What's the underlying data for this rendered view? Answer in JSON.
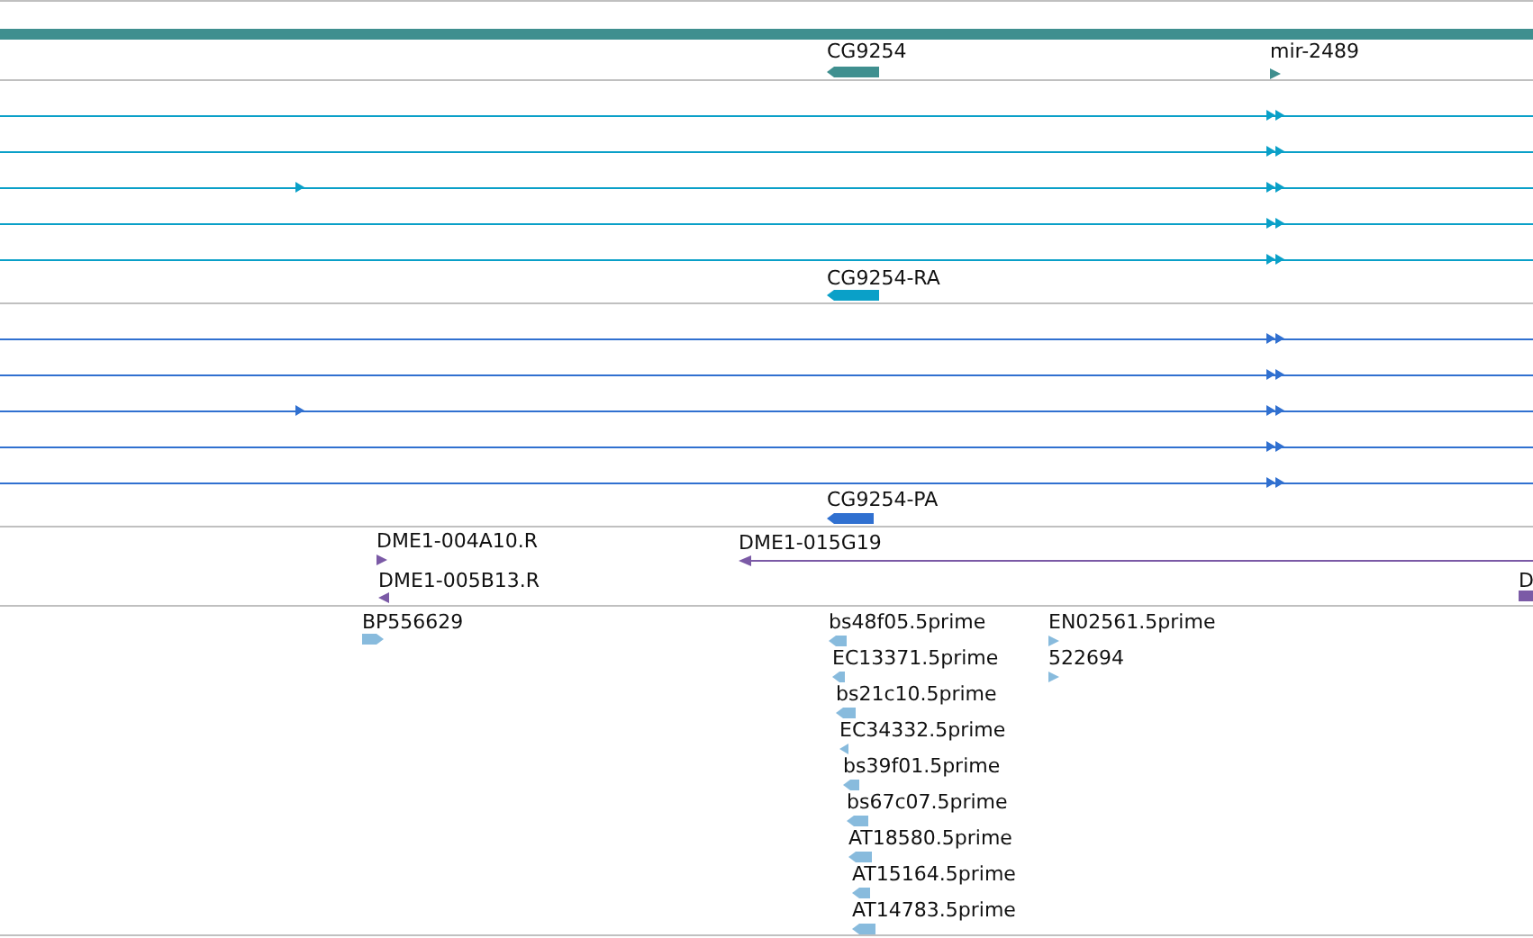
{
  "tracks": [
    {
      "kind": "genes",
      "features": [
        {
          "label": "CG9254",
          "reverse": true
        },
        {
          "label": "mir-2489",
          "reverse": false
        }
      ]
    },
    {
      "kind": "transcripts",
      "rows": [
        {
          "extra_arrow": false
        },
        {
          "extra_arrow": false
        },
        {
          "extra_arrow": true
        },
        {
          "extra_arrow": false
        },
        {
          "extra_arrow": false
        }
      ],
      "features": [
        {
          "label": "CG9254-RA",
          "reverse": true
        }
      ]
    },
    {
      "kind": "proteins",
      "rows": [
        {
          "extra_arrow": false
        },
        {
          "extra_arrow": false
        },
        {
          "extra_arrow": true
        },
        {
          "extra_arrow": false
        },
        {
          "extra_arrow": false
        }
      ],
      "features": [
        {
          "label": "CG9254-PA",
          "reverse": true
        }
      ]
    },
    {
      "kind": "clones",
      "features": [
        {
          "label": "DME1-004A10.R",
          "reverse": false
        },
        {
          "label": "DME1-005B13.R",
          "reverse": true
        },
        {
          "label": "DME1-015G19",
          "reverse": true
        },
        {
          "label": "D"
        }
      ]
    },
    {
      "kind": "ests",
      "features": [
        {
          "label": "BP556629",
          "reverse": false
        },
        {
          "label": "bs48f05.5prime",
          "reverse": true
        },
        {
          "label": "EN02561.5prime",
          "reverse": false
        },
        {
          "label": "EC13371.5prime",
          "reverse": true
        },
        {
          "label": "522694",
          "reverse": false
        },
        {
          "label": "bs21c10.5prime",
          "reverse": true
        },
        {
          "label": "EC34332.5prime",
          "reverse": true
        },
        {
          "label": "bs39f01.5prime",
          "reverse": true
        },
        {
          "label": "bs67c07.5prime",
          "reverse": true
        },
        {
          "label": "AT18580.5prime",
          "reverse": true
        },
        {
          "label": "AT15164.5prime",
          "reverse": true
        },
        {
          "label": "AT14783.5prime",
          "reverse": true
        }
      ]
    }
  ]
}
